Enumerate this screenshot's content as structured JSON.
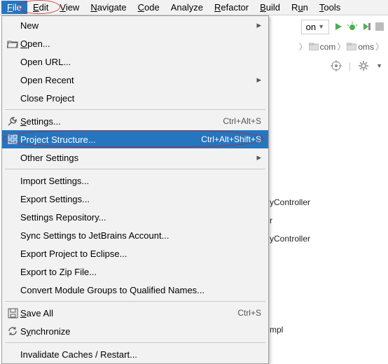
{
  "menubar": {
    "items": [
      {
        "label": "File",
        "mn": "F",
        "active": true
      },
      {
        "label": "Edit",
        "mn": "E"
      },
      {
        "label": "View",
        "mn": "V"
      },
      {
        "label": "Navigate",
        "mn": "N"
      },
      {
        "label": "Code",
        "mn": "C"
      },
      {
        "label": "Analyze"
      },
      {
        "label": "Refactor",
        "mn": "R"
      },
      {
        "label": "Build",
        "mn": "B"
      },
      {
        "label": "Run",
        "mn": "u"
      },
      {
        "label": "Tools",
        "mn": "T"
      }
    ]
  },
  "toolbar": {
    "run_config": "on",
    "run_icon": "run",
    "debug_icon": "debug"
  },
  "breadcrumb": {
    "items": [
      "com",
      "oms"
    ]
  },
  "bg_list": {
    "items": [
      "yController",
      "r",
      "yController"
    ],
    "bottom": "mpl"
  },
  "menu": {
    "groups": [
      {
        "items": [
          {
            "label": "New",
            "submenu": true
          },
          {
            "label": "Open...",
            "mn": "O",
            "icon": "folder-open"
          },
          {
            "label": "Open URL..."
          },
          {
            "label": "Open Recent",
            "submenu": true
          },
          {
            "label": "Close Project"
          }
        ]
      },
      {
        "items": [
          {
            "label": "Settings...",
            "mn": "S",
            "shortcut": "Ctrl+Alt+S",
            "icon": "wrench"
          },
          {
            "label": "Project Structure...",
            "shortcut": "Ctrl+Alt+Shift+S",
            "icon": "modules",
            "selected": true
          },
          {
            "label": "Other Settings",
            "submenu": true
          }
        ]
      },
      {
        "items": [
          {
            "label": "Import Settings..."
          },
          {
            "label": "Export Settings..."
          },
          {
            "label": "Settings Repository..."
          },
          {
            "label": "Sync Settings to JetBrains Account..."
          },
          {
            "label": "Export Project to Eclipse..."
          },
          {
            "label": "Export to Zip File..."
          },
          {
            "label": "Convert Module Groups to Qualified Names..."
          }
        ]
      },
      {
        "items": [
          {
            "label": "Save All",
            "mn": "S",
            "shortcut": "Ctrl+S",
            "icon": "save"
          },
          {
            "label": "Synchronize",
            "mn": "y",
            "icon": "sync"
          }
        ]
      },
      {
        "items": [
          {
            "label": "Invalidate Caches / Restart..."
          }
        ]
      }
    ]
  }
}
